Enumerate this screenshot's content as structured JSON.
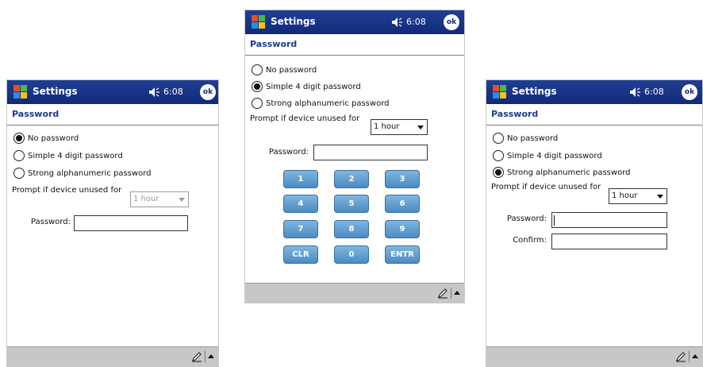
{
  "screens": [
    {
      "title": "Settings",
      "time": "6:08",
      "ok": "ok",
      "subtitle": "Password",
      "options": [
        "No password",
        "Simple 4 digit password",
        "Strong alphanumeric password"
      ],
      "selected_option": "No password",
      "prompt": "Prompt if device unused for",
      "prompt_value": "1 hour",
      "password_label": "Password:"
    },
    {
      "title": "Settings",
      "time": "6:08",
      "ok": "ok",
      "subtitle": "Password",
      "options": [
        "No password",
        "Simple 4 digit password",
        "Strong alphanumeric password"
      ],
      "selected_option": "Simple 4 digit password",
      "prompt": "Prompt if device unused for",
      "prompt_value": "1 hour",
      "password_label": "Password:",
      "keypad": [
        "1",
        "2",
        "3",
        "4",
        "5",
        "6",
        "7",
        "8",
        "9",
        "CLR",
        "0",
        "ENTR"
      ]
    },
    {
      "title": "Settings",
      "time": "6:08",
      "ok": "ok",
      "subtitle": "Password",
      "options": [
        "No password",
        "Simple 4 digit password",
        "Strong alphanumeric password"
      ],
      "selected_option": "Strong alphanumeric password",
      "prompt": "Prompt if device unused for",
      "prompt_value": "1 hour",
      "password_label": "Password:",
      "confirm_label": "Confirm:"
    }
  ],
  "icons": {
    "start": "windows-flag-icon",
    "speaker": "speaker-icon",
    "pen": "pen-icon",
    "up": "up-arrow-icon"
  },
  "colors": {
    "titlebar": "#1f3f93",
    "subtitle": "#1c3a8c",
    "key": "#5e9dd0",
    "bottombar": "#c7c7c7"
  }
}
